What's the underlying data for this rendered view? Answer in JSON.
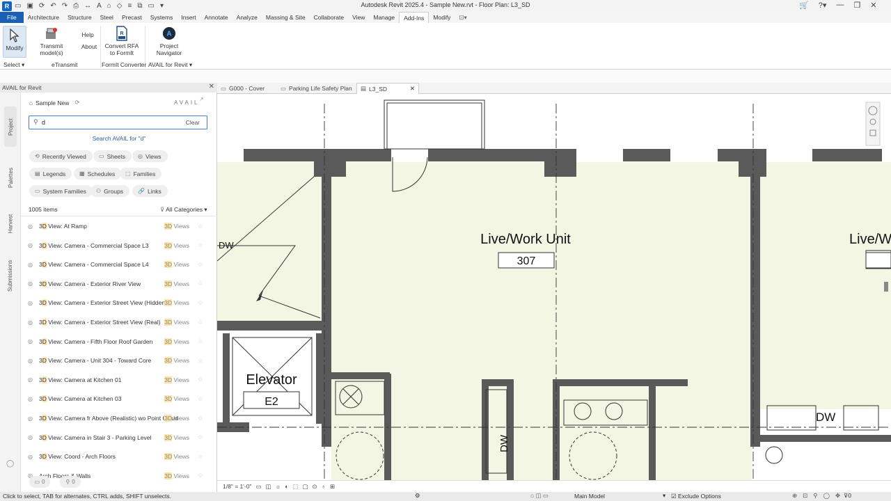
{
  "titlebar": {
    "title": "Autodesk Revit 2025.4 - Sample New.rvt - Floor Plan: L3_SD",
    "logo": "R"
  },
  "menubar": {
    "tabs": [
      "File",
      "Architecture",
      "Structure",
      "Steel",
      "Precast",
      "Systems",
      "Insert",
      "Annotate",
      "Analyze",
      "Massing & Site",
      "Collaborate",
      "View",
      "Manage",
      "Add-Ins",
      "Modify"
    ],
    "active": "Add-Ins"
  },
  "ribbon": {
    "modify": "Modify",
    "transmit": "Transmit model(s)",
    "help": "Help",
    "about": "About",
    "convert": "Convert RFA to FormIt",
    "navigator": "Project Navigator",
    "groups": {
      "select": "Select",
      "etransmit": "eTransmit",
      "formit": "FormIt Converter",
      "avail": "AVAIL for Revit"
    }
  },
  "panel": {
    "title": "AVAIL for Revit",
    "vtabs": [
      "Project",
      "Palettes",
      "Harvest",
      "Submissions"
    ],
    "project_name": "Sample New",
    "brand": "AVAIL",
    "search_value": "d",
    "clear_label": "Clear",
    "search_hint": "Search AVAIL for \"d\"",
    "chips": [
      "Recently Viewed",
      "Sheets",
      "Views",
      "Legends",
      "Schedules",
      "Families",
      "System Families",
      "Groups",
      "Links"
    ],
    "count": "1005 items",
    "filter": "All Categories",
    "items": [
      {
        "pre": "3",
        "hl": "D",
        "post": " View: At Ramp",
        "type": "Views"
      },
      {
        "pre": "3",
        "hl": "D",
        "post": " View: Camera - Commercial Space L3",
        "type": "Views"
      },
      {
        "pre": "3",
        "hl": "D",
        "post": " View: Camera - Commercial Space L4",
        "type": "Views"
      },
      {
        "pre": "3",
        "hl": "D",
        "post": " View: Camera - Exterior River View",
        "type": "Views"
      },
      {
        "pre": "3",
        "hl": "D",
        "post": " View: Camera - Exterior Street View (Hidden)",
        "type": "Views"
      },
      {
        "pre": "3",
        "hl": "D",
        "post": " View: Camera - Exterior Street View (Real)",
        "type": "Views"
      },
      {
        "pre": "3",
        "hl": "D",
        "post": " View: Camera - Fifth Floor Roof Garden",
        "type": "Views"
      },
      {
        "pre": "3",
        "hl": "D",
        "post": " View: Camera - Unit 304 - Toward Core",
        "type": "Views"
      },
      {
        "pre": "3",
        "hl": "D",
        "post": " View: Camera at Kitchen 01",
        "type": "Views"
      },
      {
        "pre": "3",
        "hl": "D",
        "post": " View: Camera at Kitchen 03",
        "type": "Views"
      },
      {
        "pre": "3",
        "hl": "D",
        "post": " View: Camera fr Above (Realistic) wo Point Cloud",
        "type": "Views"
      },
      {
        "pre": "3",
        "hl": "D",
        "post": " View: Camera in Stair 3 - Parking Level",
        "type": "Views"
      },
      {
        "pre": "3",
        "hl": "D",
        "post": " View: Coord - Arch Floors",
        "type": "Views"
      },
      {
        "pre": "",
        "hl": "",
        "post": "Arch Floors & Walls",
        "type": "Views"
      }
    ],
    "footer_left": "0",
    "footer_right": "0"
  },
  "viewtabs": [
    {
      "label": "G000 - Cover"
    },
    {
      "label": "Parking Life Safety Plan"
    },
    {
      "label": "L3_SD",
      "active": true
    }
  ],
  "plan": {
    "room1": "Live/Work Unit",
    "room1_num": "307",
    "room2": "Live/W",
    "elevator": "Elevator",
    "elevator_num": "E2",
    "dw1": "DW",
    "dw2": "DW",
    "dw3": "DW",
    "wall_fill": "#5a5a5a",
    "room_fill": "#f3f6e3"
  },
  "viewbar": {
    "scale": "1/8\" = 1'-0\""
  },
  "statusbar": {
    "hint": "Click to select, TAB for alternates, CTRL adds, SHIFT unselects.",
    "model": "Main Model",
    "exclude": "Exclude Options",
    "filter_count": "0"
  }
}
